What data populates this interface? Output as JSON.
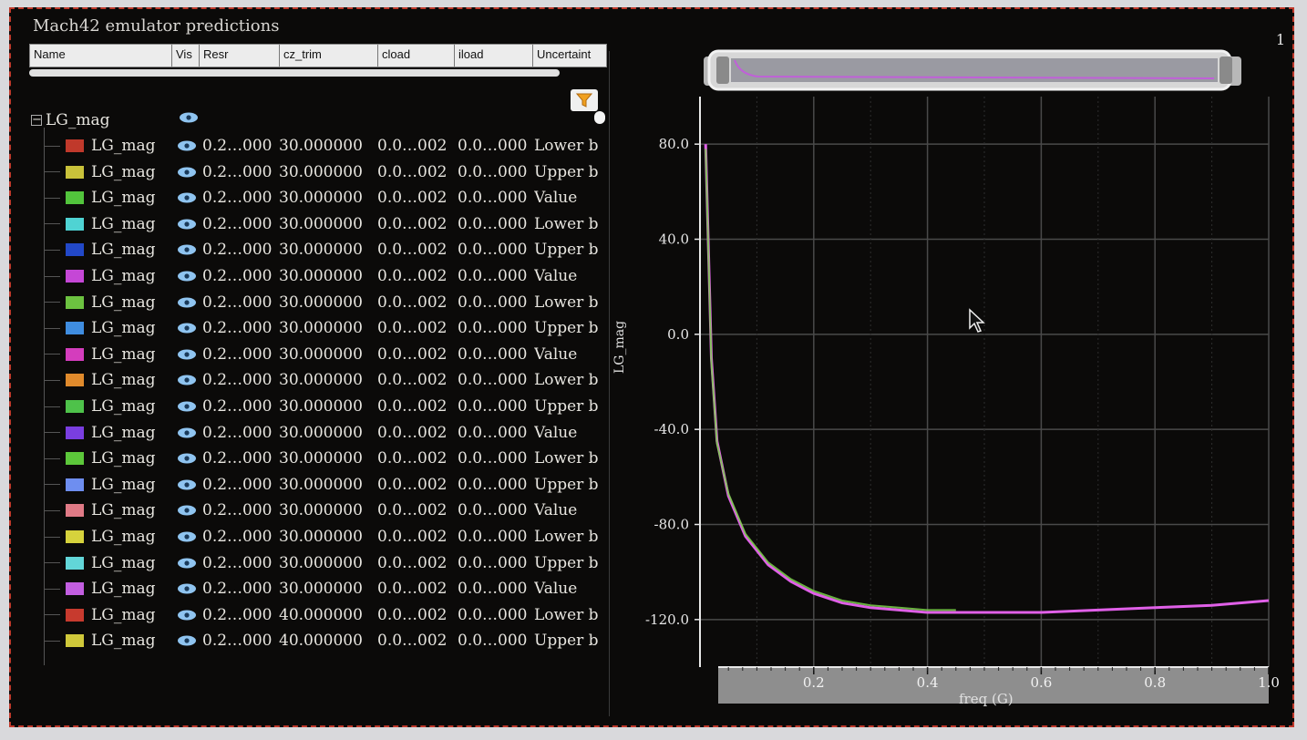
{
  "window": {
    "title": "Mach42 emulator predictions",
    "corner_number": "1"
  },
  "columns": [
    "Name",
    "Vis",
    "Resr",
    "cz_trim",
    "cload",
    "iload",
    "Uncertaint"
  ],
  "tree_root": {
    "label": "LG_mag",
    "expander": "−"
  },
  "rows": [
    {
      "name": "LG_mag",
      "color": "#c0392b",
      "resr": "0.2…000",
      "cz_trim": "30.000000",
      "cload": "0.0…002",
      "iload": "0.0…000",
      "unc": "Lower b"
    },
    {
      "name": "LG_mag",
      "color": "#c9c23a",
      "resr": "0.2…000",
      "cz_trim": "30.000000",
      "cload": "0.0…002",
      "iload": "0.0…000",
      "unc": "Upper b"
    },
    {
      "name": "LG_mag",
      "color": "#52c43c",
      "resr": "0.2…000",
      "cz_trim": "30.000000",
      "cload": "0.0…002",
      "iload": "0.0…000",
      "unc": "Value"
    },
    {
      "name": "LG_mag",
      "color": "#4fd3d3",
      "resr": "0.2…000",
      "cz_trim": "30.000000",
      "cload": "0.0…002",
      "iload": "0.0…000",
      "unc": "Lower b"
    },
    {
      "name": "LG_mag",
      "color": "#2248c8",
      "resr": "0.2…000",
      "cz_trim": "30.000000",
      "cload": "0.0…002",
      "iload": "0.0…000",
      "unc": "Upper b"
    },
    {
      "name": "LG_mag",
      "color": "#c547d6",
      "resr": "0.2…000",
      "cz_trim": "30.000000",
      "cload": "0.0…002",
      "iload": "0.0…000",
      "unc": "Value"
    },
    {
      "name": "LG_mag",
      "color": "#6cc240",
      "resr": "0.2…000",
      "cz_trim": "30.000000",
      "cload": "0.0…002",
      "iload": "0.0…000",
      "unc": "Lower b"
    },
    {
      "name": "LG_mag",
      "color": "#3f8de0",
      "resr": "0.2…000",
      "cz_trim": "30.000000",
      "cload": "0.0…002",
      "iload": "0.0…000",
      "unc": "Upper b"
    },
    {
      "name": "LG_mag",
      "color": "#d43dbd",
      "resr": "0.2…000",
      "cz_trim": "30.000000",
      "cload": "0.0…002",
      "iload": "0.0…000",
      "unc": "Value"
    },
    {
      "name": "LG_mag",
      "color": "#e08a2c",
      "resr": "0.2…000",
      "cz_trim": "30.000000",
      "cload": "0.0…002",
      "iload": "0.0…000",
      "unc": "Lower b"
    },
    {
      "name": "LG_mag",
      "color": "#4ec24a",
      "resr": "0.2…000",
      "cz_trim": "30.000000",
      "cload": "0.0…002",
      "iload": "0.0…000",
      "unc": "Upper b"
    },
    {
      "name": "LG_mag",
      "color": "#7a3ee0",
      "resr": "0.2…000",
      "cz_trim": "30.000000",
      "cload": "0.0…002",
      "iload": "0.0…000",
      "unc": "Value"
    },
    {
      "name": "LG_mag",
      "color": "#5cc73a",
      "resr": "0.2…000",
      "cz_trim": "30.000000",
      "cload": "0.0…002",
      "iload": "0.0…000",
      "unc": "Lower b"
    },
    {
      "name": "LG_mag",
      "color": "#6e8ef0",
      "resr": "0.2…000",
      "cz_trim": "30.000000",
      "cload": "0.0…002",
      "iload": "0.0…000",
      "unc": "Upper b"
    },
    {
      "name": "LG_mag",
      "color": "#e07a86",
      "resr": "0.2…000",
      "cz_trim": "30.000000",
      "cload": "0.0…002",
      "iload": "0.0…000",
      "unc": "Value"
    },
    {
      "name": "LG_mag",
      "color": "#d6d23c",
      "resr": "0.2…000",
      "cz_trim": "30.000000",
      "cload": "0.0…002",
      "iload": "0.0…000",
      "unc": "Lower b"
    },
    {
      "name": "LG_mag",
      "color": "#62d6d8",
      "resr": "0.2…000",
      "cz_trim": "30.000000",
      "cload": "0.0…002",
      "iload": "0.0…000",
      "unc": "Upper b"
    },
    {
      "name": "LG_mag",
      "color": "#c25ee0",
      "resr": "0.2…000",
      "cz_trim": "30.000000",
      "cload": "0.0…002",
      "iload": "0.0…000",
      "unc": "Value"
    },
    {
      "name": "LG_mag",
      "color": "#c73a2e",
      "resr": "0.2…000",
      "cz_trim": "40.000000",
      "cload": "0.0…002",
      "iload": "0.0…000",
      "unc": "Lower b"
    },
    {
      "name": "LG_mag",
      "color": "#cfc83a",
      "resr": "0.2…000",
      "cz_trim": "40.000000",
      "cload": "0.0…002",
      "iload": "0.0…000",
      "unc": "Upper b"
    }
  ],
  "chart_data": {
    "type": "line",
    "xlabel": "freq (G)",
    "ylabel": "LG_mag",
    "xlim": [
      0.0,
      1.0
    ],
    "ylim": [
      -140,
      100
    ],
    "xticks": [
      "0.2",
      "0.4",
      "0.6",
      "0.8",
      "1.0"
    ],
    "yticks": [
      "80.0",
      "40.0",
      "0.0",
      "-40.0",
      "-80.0",
      "-120.0"
    ],
    "grid": true,
    "series": [
      {
        "color": "#e060e8",
        "x": [
          0.01,
          0.02,
          0.03,
          0.05,
          0.08,
          0.12,
          0.16,
          0.2,
          0.25,
          0.3,
          0.35,
          0.4,
          0.5,
          0.6,
          0.7,
          0.8,
          0.9,
          1.0
        ],
        "y": [
          80,
          -10,
          -45,
          -68,
          -85,
          -97,
          -104,
          -109,
          -113,
          -115,
          -116,
          -117,
          -117,
          -117,
          -116,
          -115,
          -114,
          -112
        ]
      },
      {
        "color": "#7ad04a",
        "x": [
          0.01,
          0.02,
          0.03,
          0.05,
          0.08,
          0.12,
          0.16,
          0.2,
          0.25,
          0.3,
          0.35,
          0.4,
          0.45
        ],
        "y": [
          78,
          -12,
          -46,
          -67,
          -84,
          -96,
          -103,
          -108,
          -112,
          -114,
          -115,
          -116,
          -116
        ]
      }
    ]
  },
  "colors": {
    "grid": "#4a4a4a",
    "axis": "#e8e8e8",
    "background": "#0b0a09"
  }
}
